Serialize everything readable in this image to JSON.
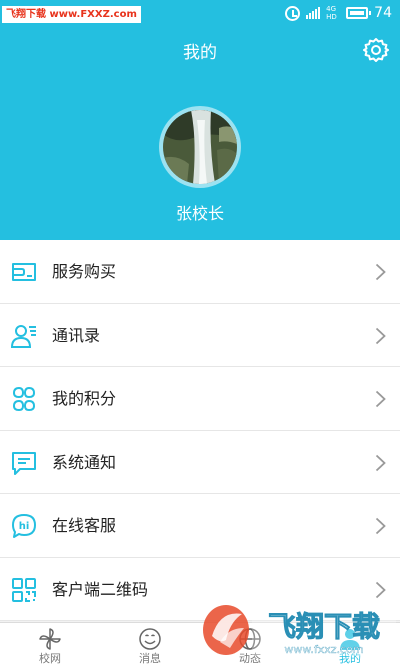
{
  "status_bar": {
    "watermark": "飞翔下载 www.FXXZ.com",
    "battery_level": "74"
  },
  "header": {
    "title": "我的",
    "user_name": "张校长"
  },
  "menu": {
    "items": [
      {
        "label": "服务购买",
        "icon": "service-purchase-icon"
      },
      {
        "label": "通讯录",
        "icon": "contacts-icon"
      },
      {
        "label": "我的积分",
        "icon": "points-icon"
      },
      {
        "label": "系统通知",
        "icon": "notification-icon"
      },
      {
        "label": "在线客服",
        "icon": "customer-service-icon"
      },
      {
        "label": "客户端二维码",
        "icon": "qr-code-icon"
      }
    ]
  },
  "tabbar": {
    "tabs": [
      {
        "label": "校网",
        "icon": "pinwheel-icon",
        "active": false
      },
      {
        "label": "消息",
        "icon": "smiley-icon",
        "active": false
      },
      {
        "label": "动态",
        "icon": "globe-icon",
        "active": false
      },
      {
        "label": "我的",
        "icon": "person-icon",
        "active": true
      }
    ]
  },
  "corner_logo": {
    "text": "飞翔下载",
    "url": "www.fxxz.com"
  },
  "colors": {
    "accent": "#24bfe0",
    "divider": "#e6e6e6",
    "watermark_red": "#e8331c"
  }
}
